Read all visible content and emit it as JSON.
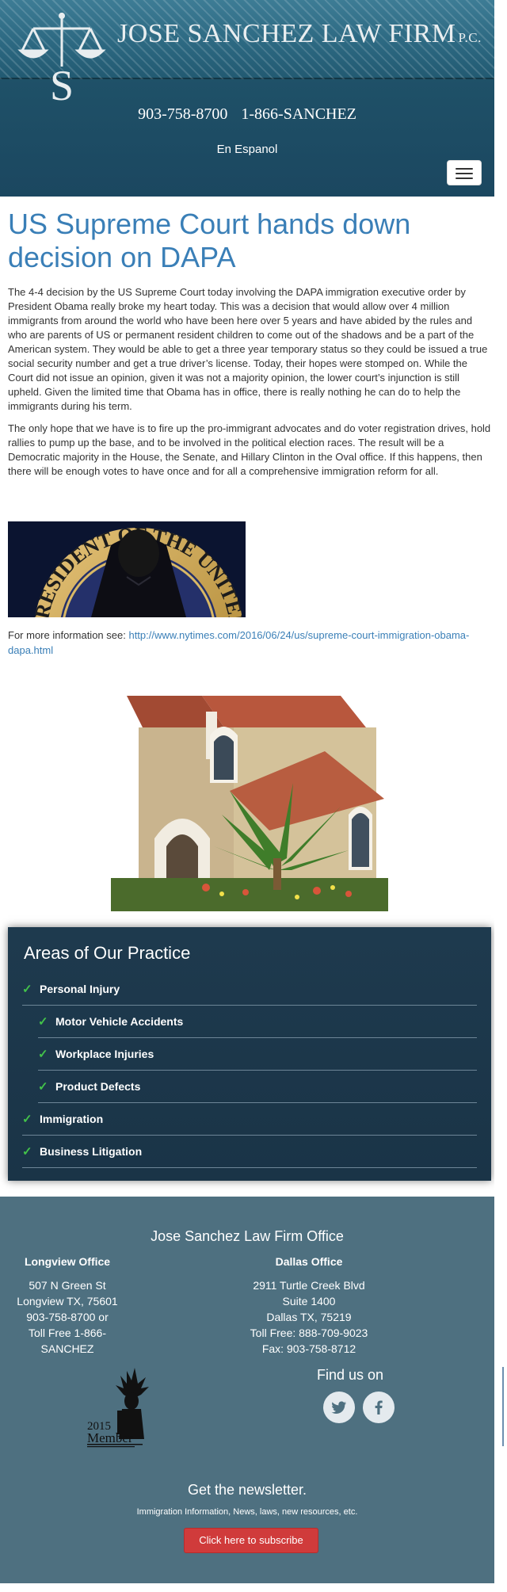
{
  "header": {
    "firm_name": "JOSE SANCHEZ LAW FIRM",
    "firm_suffix": "P.C.",
    "phone_1": "903-758-8700",
    "phone_2": "1-866-SANCHEZ",
    "language_link": "En Espanol",
    "logo_letter": "S"
  },
  "article": {
    "title": "US Supreme Court hands down decision on DAPA",
    "paragraphs": [
      "The 4-4 decision by the US Supreme Court today involving the DAPA immigration executive order by President Obama really broke my heart today. This was a decision that would allow over 4 million immigrants from around the world who have been here over 5 years and have abided by the rules and who are parents of US or permanent resident children to come out of the shadows and be a part of the American system. They would be able to get a three year temporary status so they could be issued a true social security number and get a true driver’s license. Today, their hopes were stomped on. While the Court did not issue an opinion, given it was not a majority opinion, the lower court’s injunction is still upheld. Given the limited time that Obama has in office, there is really nothing he can do to help the immigrants during his term.",
      "The only hope that we have is to fire up the pro-immigrant advocates and do voter registration drives, hold rallies to pump up the base, and to be involved in the political election races. The result will be a Democratic majority in the House, the Senate, and Hillary Clinton in the Oval office. If this happens, then there will be enough votes to have once and for all a comprehensive immigration reform for all."
    ],
    "more_info_label": "For more information see:",
    "more_info_link": "http://www.nytimes.com/2016/06/24/us/supreme-court-immigration-obama-dapa.html",
    "seal_text": "PRESIDENT OF THE UNITED"
  },
  "practice": {
    "title": "Areas of Our Practice",
    "items": [
      {
        "label": "Personal Injury",
        "sub": false
      },
      {
        "label": "Motor Vehicle Accidents",
        "sub": true
      },
      {
        "label": "Workplace Injuries",
        "sub": true
      },
      {
        "label": "Product Defects",
        "sub": true
      },
      {
        "label": "Immigration",
        "sub": false
      },
      {
        "label": "Business Litigation",
        "sub": false
      }
    ]
  },
  "footer": {
    "title": "Jose Sanchez Law Firm Office",
    "longview": {
      "heading": "Longview Office",
      "lines": [
        "507 N Green St",
        "Longview TX, 75601",
        "903-758-8700 or",
        "Toll Free 1-866-",
        "SANCHEZ"
      ]
    },
    "dallas": {
      "heading": "Dallas Office",
      "lines": [
        "2911 Turtle Creek Blvd",
        "Suite 1400",
        "Dallas TX, 75219",
        "Toll Free: 888-709-9023",
        "Fax: 903-758-8712"
      ]
    },
    "find_us": "Find us on",
    "badge_year": "2015",
    "badge_word": "Member",
    "newsletter_title": "Get the newsletter.",
    "newsletter_sub": "Immigration Information, News, laws, new resources, etc.",
    "subscribe_label": "Click here to subscribe"
  },
  "colors": {
    "header_bg": "#1f5168",
    "headline": "#3a7fb7",
    "practice_bg": "#1e3a4e",
    "check": "#43c24a",
    "footer_bg": "#4e7080",
    "subscribe_bg": "#d03b3b"
  },
  "icons": {
    "logo": "scales-of-justice-icon",
    "menu": "hamburger-menu-icon",
    "check": "check-icon",
    "twitter": "twitter-icon",
    "facebook": "facebook-icon"
  }
}
